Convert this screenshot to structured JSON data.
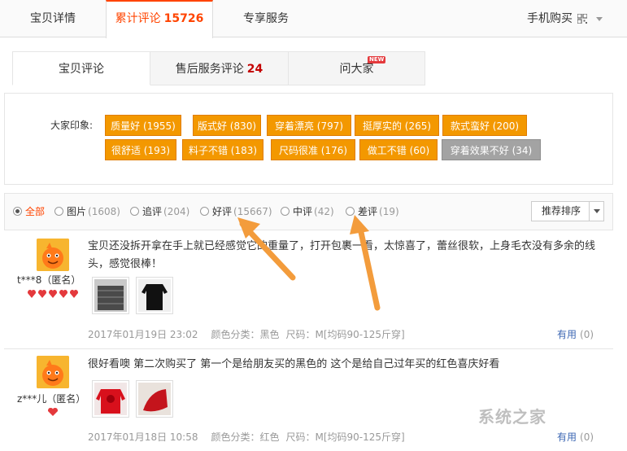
{
  "top_nav": {
    "tabs": [
      {
        "label": "宝贝详情",
        "count": ""
      },
      {
        "label": "累计评论",
        "count": "15726"
      },
      {
        "label": "专享服务",
        "count": ""
      }
    ],
    "mobile_buy": "手机购买"
  },
  "sub_tabs": [
    {
      "label": "宝贝评论",
      "count": ""
    },
    {
      "label": "售后服务评论",
      "count": "24"
    },
    {
      "label": "问大家",
      "count": ""
    }
  ],
  "new_badge": "NEW",
  "impression": {
    "label": "大家印象:",
    "tags": [
      {
        "text": "质量好 (1955)"
      },
      {
        "text": "版式好 (830)"
      },
      {
        "text": "穿着漂亮 (797)"
      },
      {
        "text": "挺厚实的 (265)"
      },
      {
        "text": "款式蛮好 (200)"
      },
      {
        "text": "很舒适 (193)"
      },
      {
        "text": "料子不错 (183)"
      },
      {
        "text": "尺码很准 (176)"
      },
      {
        "text": "做工不错 (60)"
      },
      {
        "text": "穿着效果不好 (34)",
        "negative": true
      }
    ]
  },
  "filters": [
    {
      "label": "全部",
      "count": ""
    },
    {
      "label": "图片",
      "count": "(1608)"
    },
    {
      "label": "追评",
      "count": "(204)"
    },
    {
      "label": "好评",
      "count": "(15667)"
    },
    {
      "label": "中评",
      "count": "(42)"
    },
    {
      "label": "差评",
      "count": "(19)"
    }
  ],
  "sort_label": "推荐排序",
  "reviews": [
    {
      "user": "t***8（匿名）",
      "text": "宝贝还没拆开拿在手上就已经感觉它的重量了，打开包裹一看，太惊喜了，蕾丝很软，上身毛衣没有多余的线头，感觉很棒！",
      "date": "2017年01月19日 23:02",
      "color": "颜色分类：黑色",
      "size": "尺码：M[均码90-125斤穿]",
      "useful": "有用",
      "useful_count": "(0)"
    },
    {
      "user": "z***儿（匿名）",
      "text": "很好看噢 第二次购买了 第一个是给朋友买的黑色的 这个是给自己过年买的红色喜庆好看",
      "date": "2017年01月18日 10:58",
      "color": "颜色分类：红色",
      "size": "尺码：M[均码90-125斤穿]",
      "useful": "有用",
      "useful_count": "(0)"
    }
  ],
  "watermark": "系统之家",
  "colors": {
    "accent": "#ff4400",
    "tag": "#f39800",
    "tag_negative": "#a3a3a3",
    "arrow": "#f39c3c",
    "link": "#3c67b3"
  }
}
